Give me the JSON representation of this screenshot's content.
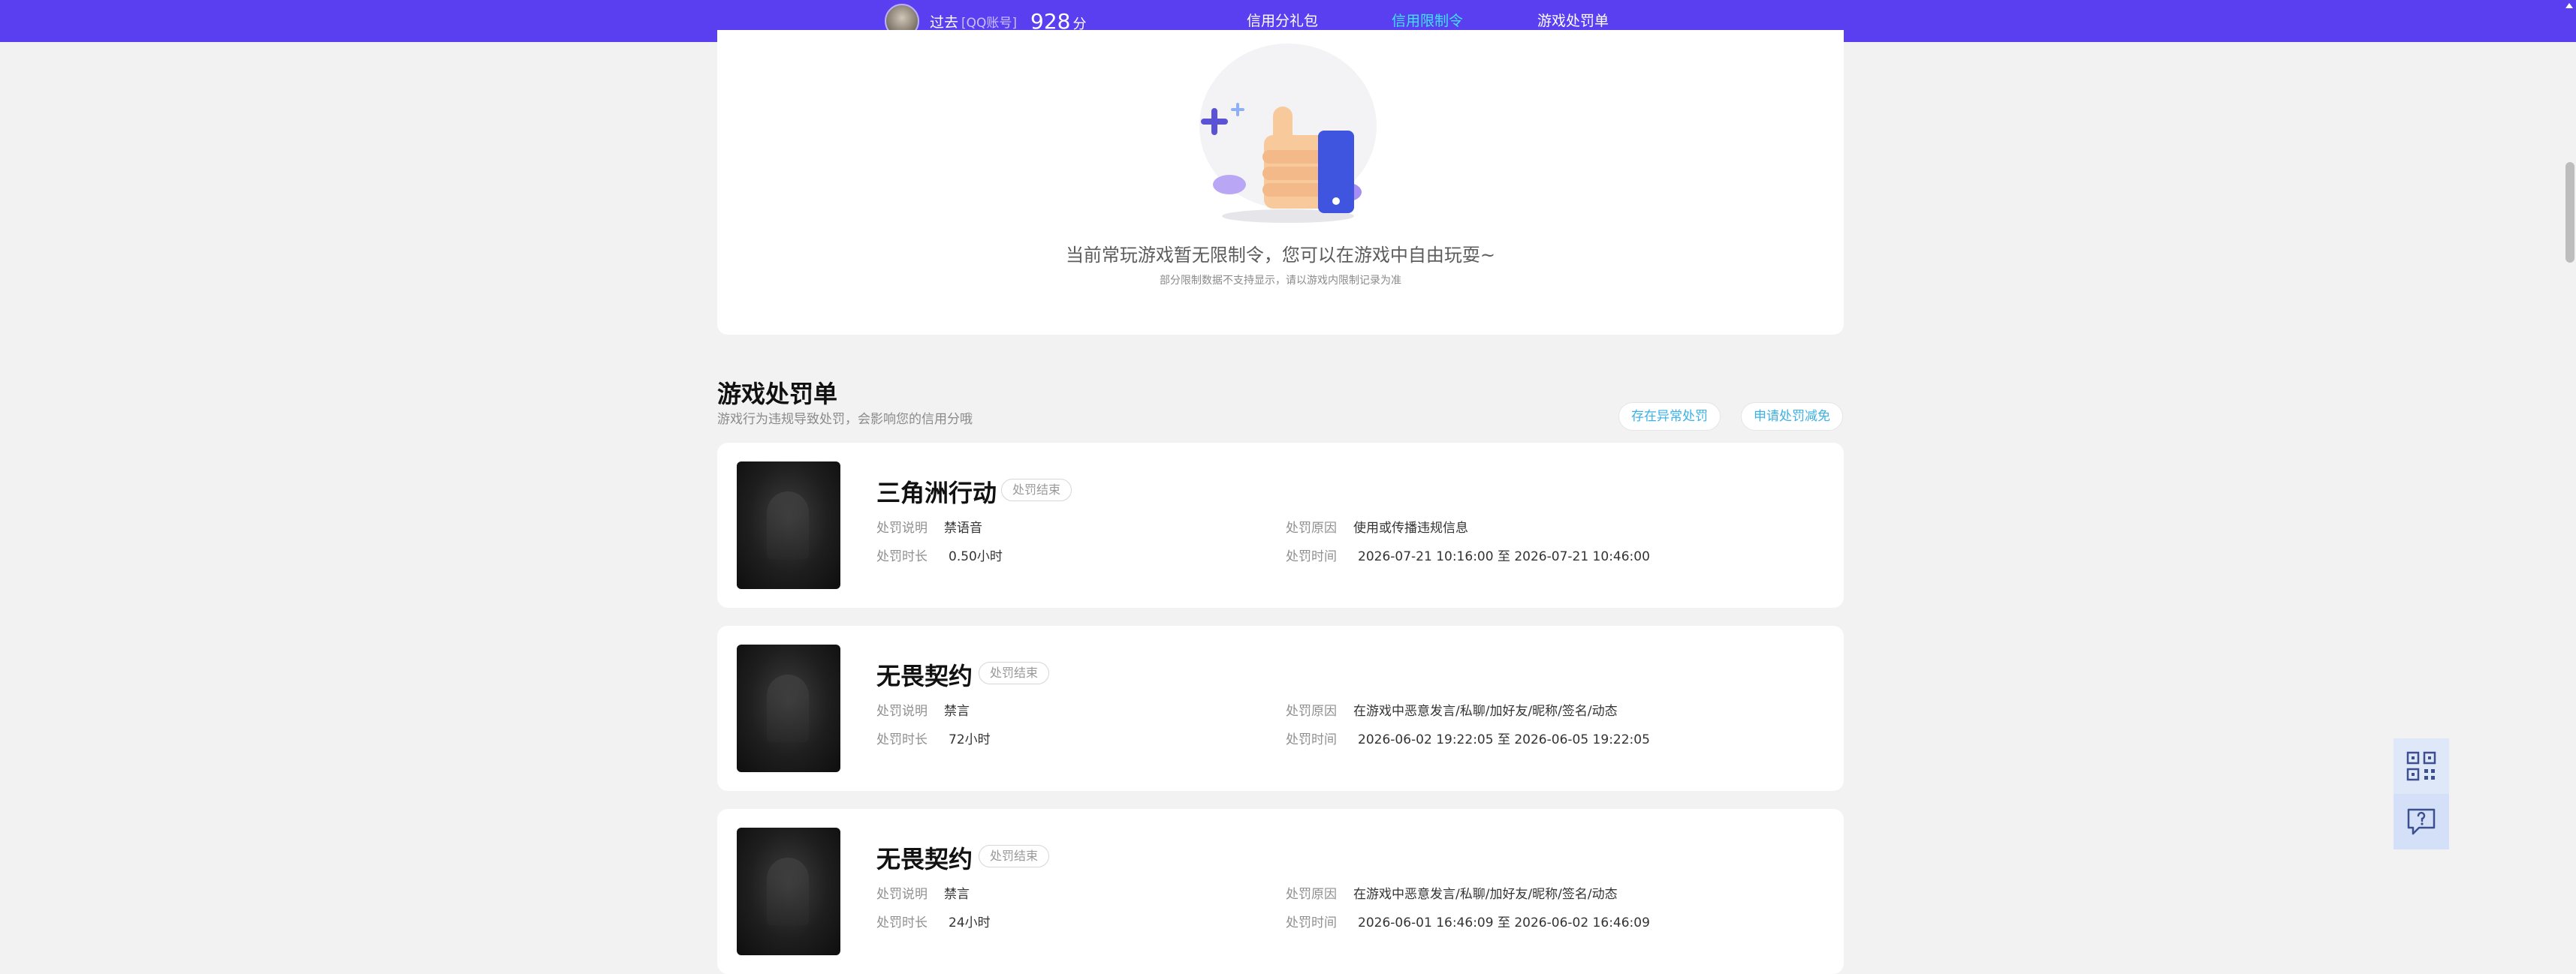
{
  "topbar": {
    "user_name": "过去",
    "account_type": "[QQ账号]",
    "score": "928",
    "score_unit": "分",
    "nav": [
      {
        "label": "信用分礼包",
        "active": false
      },
      {
        "label": "信用限制令",
        "active": true
      },
      {
        "label": "游戏处罚单",
        "active": false
      }
    ]
  },
  "restriction": {
    "empty_text": "当前常玩游戏暂无限制令，您可以在游戏中自由玩耍~",
    "empty_subtext": "部分限制数据不支持显示，请以游戏内限制记录为准"
  },
  "penalty_section": {
    "title": "游戏处罚单",
    "subtitle": "游戏行为违规导致处罚，会影响您的信用分哦",
    "abnormal_button": "存在异常处罚",
    "reduce_button": "申请处罚减免"
  },
  "labels": {
    "desc": "处罚说明",
    "reason": "处罚原因",
    "duration": "处罚时长",
    "time": "处罚时间"
  },
  "penalties": [
    {
      "game": "三角洲行动",
      "status": "处罚结束",
      "description": "禁语音",
      "reason": "使用或传播违规信息",
      "duration": "0.50小时",
      "time": "2026-07-21 10:16:00 至 2026-07-21 10:46:00"
    },
    {
      "game": "无畏契约",
      "status": "处罚结束",
      "description": "禁言",
      "reason": "在游戏中恶意发言/私聊/加好友/昵称/签名/动态",
      "duration": "72小时",
      "time": "2026-06-02 19:22:05 至 2026-06-05 19:22:05"
    },
    {
      "game": "无畏契约",
      "status": "处罚结束",
      "description": "禁言",
      "reason": "在游戏中恶意发言/私聊/加好友/昵称/签名/动态",
      "duration": "24小时",
      "time": "2026-06-01 16:46:09 至 2026-06-02 16:46:09"
    }
  ],
  "icons": {
    "qrcode": "qrcode-icon",
    "feedback": "feedback-icon"
  },
  "colors": {
    "topbar": "#5a3ff0",
    "active_nav": "#3de4f0",
    "pill_text": "#3bb1e6"
  }
}
